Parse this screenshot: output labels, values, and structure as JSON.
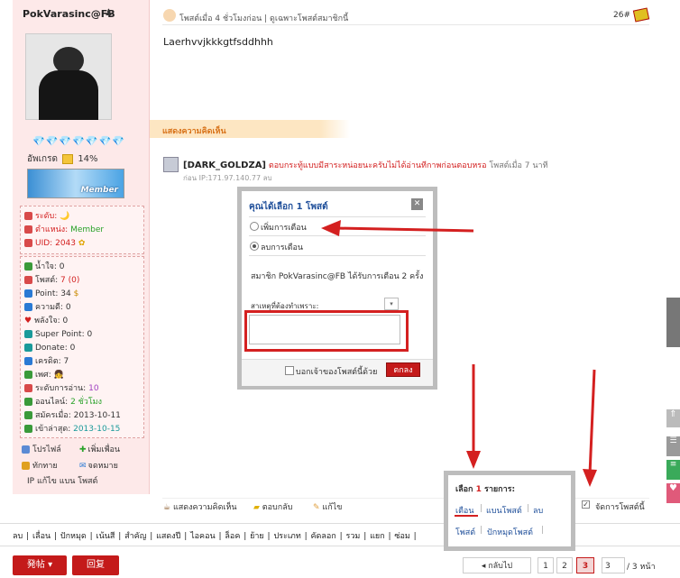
{
  "profile": {
    "name": "PokVarasinc@FB",
    "gems": "💎💎💎💎💎💎💎",
    "rank_label": "อัพเกรด",
    "rank_percent": "14%",
    "badge_text": "Member",
    "info_top": [
      {
        "label": "ระดับ:",
        "value": "🌙"
      },
      {
        "label": "ตำแหน่ง:",
        "value": "Member"
      },
      {
        "label": "UID:",
        "value": "2043"
      }
    ],
    "info_rows": [
      {
        "label": "น้ำใจ:",
        "value": "0"
      },
      {
        "label": "โพสต์:",
        "value": "7 (0)"
      },
      {
        "label": "Point:",
        "value": "34"
      },
      {
        "label": "ความดี:",
        "value": "0"
      },
      {
        "label": "พลังใจ:",
        "value": "0"
      },
      {
        "label": "Super Point:",
        "value": "0"
      },
      {
        "label": "Donate:",
        "value": "0"
      },
      {
        "label": "เครดิต:",
        "value": "7"
      },
      {
        "label": "เพศ:",
        "value": "👧"
      },
      {
        "label": "ระดับการอ่าน:",
        "value": "10"
      },
      {
        "label": "ออนไลน์:",
        "value": "2 ชั่วโมง"
      },
      {
        "label": "สมัครเมื่อ:",
        "value": "2013-10-11"
      },
      {
        "label": "เข้าล่าสุด:",
        "value": "2013-10-15"
      }
    ],
    "actions": {
      "profile": "โปรไฟล์",
      "add_friend": "เพิ่มเพื่อน",
      "greet": "ทักทาย",
      "message": "จดหมาย",
      "ip_line": "IP  แก้ไข  แบน  โพสต์"
    }
  },
  "post": {
    "meta": "โพสต์เมื่อ 4 ชั่วโมงก่อน  |  ดูเฉพาะโพสต์สมาชิกนี้",
    "number": "26#",
    "body": "Laerhvvjkkkgtfsddhhh",
    "comments_title": "แสดงความคิดเห็น",
    "comment": {
      "user": "[DARK_GOLDZA]",
      "text": "ตอบกระทู้แบบมีสาระหน่อยนะครับไม่ได้อ่านทีกาพก่อนตอบหรอ",
      "time": "โพสต์เมื่อ 7 นาที",
      "ip": "ก่อน IP:171.97.140.77 ลบ"
    },
    "toolbar": {
      "comment": "แสดงความคิดเห็น",
      "reply": "ตอบกลับ",
      "edit": "แก้ไข",
      "manage": "จัดการโพสต์นี้"
    }
  },
  "modal": {
    "title": "คุณได้เลือก 1 โพสต์",
    "close": "✕",
    "option_add": "เพิ่มการเตือน",
    "option_remove": "ลบการเตือน",
    "member_note": "สมาชิก PokVarasinc@FB ได้รับการเตือน 2 ครั้ง",
    "reason_label": "สาเหตุที่ต้องทำเพราะ:",
    "notify_label": "บอกเจ้าของโพสต์นี้ด้วย",
    "confirm": "ตกลง"
  },
  "selection": {
    "title_prefix": "เลือก",
    "count": "1",
    "title_suffix": "รายการ:",
    "links_row1": [
      "เตือน",
      "แบนโพสต์",
      "ลบ"
    ],
    "links_row2": [
      "โพสต์",
      "ปักหมุดโพสต์"
    ]
  },
  "modbar": {
    "items": "ลบ  |  เลื่อน  |  ปักหมุด  |  เน้นสี  |  สำคัญ  |  แสดงปี  |  ไอคอน  |  ล็อค  |  ย้าย  |  ประเภท  |  คัดลอก  |  รวม  |  แยก  |  ซ่อม  |"
  },
  "buttons": {
    "post": "発帖 ▾",
    "reply": "回复"
  },
  "pagination": {
    "prev": "◂ กลับไป",
    "pages": [
      "1",
      "2",
      "3"
    ],
    "current": "3",
    "input": "3",
    "total": "/ 3 หน้า"
  },
  "colors": {
    "accent": "#c41a1a",
    "profile_bg": "#fde9e9",
    "link": "#1f4f9a",
    "highlight": "#d42020"
  }
}
